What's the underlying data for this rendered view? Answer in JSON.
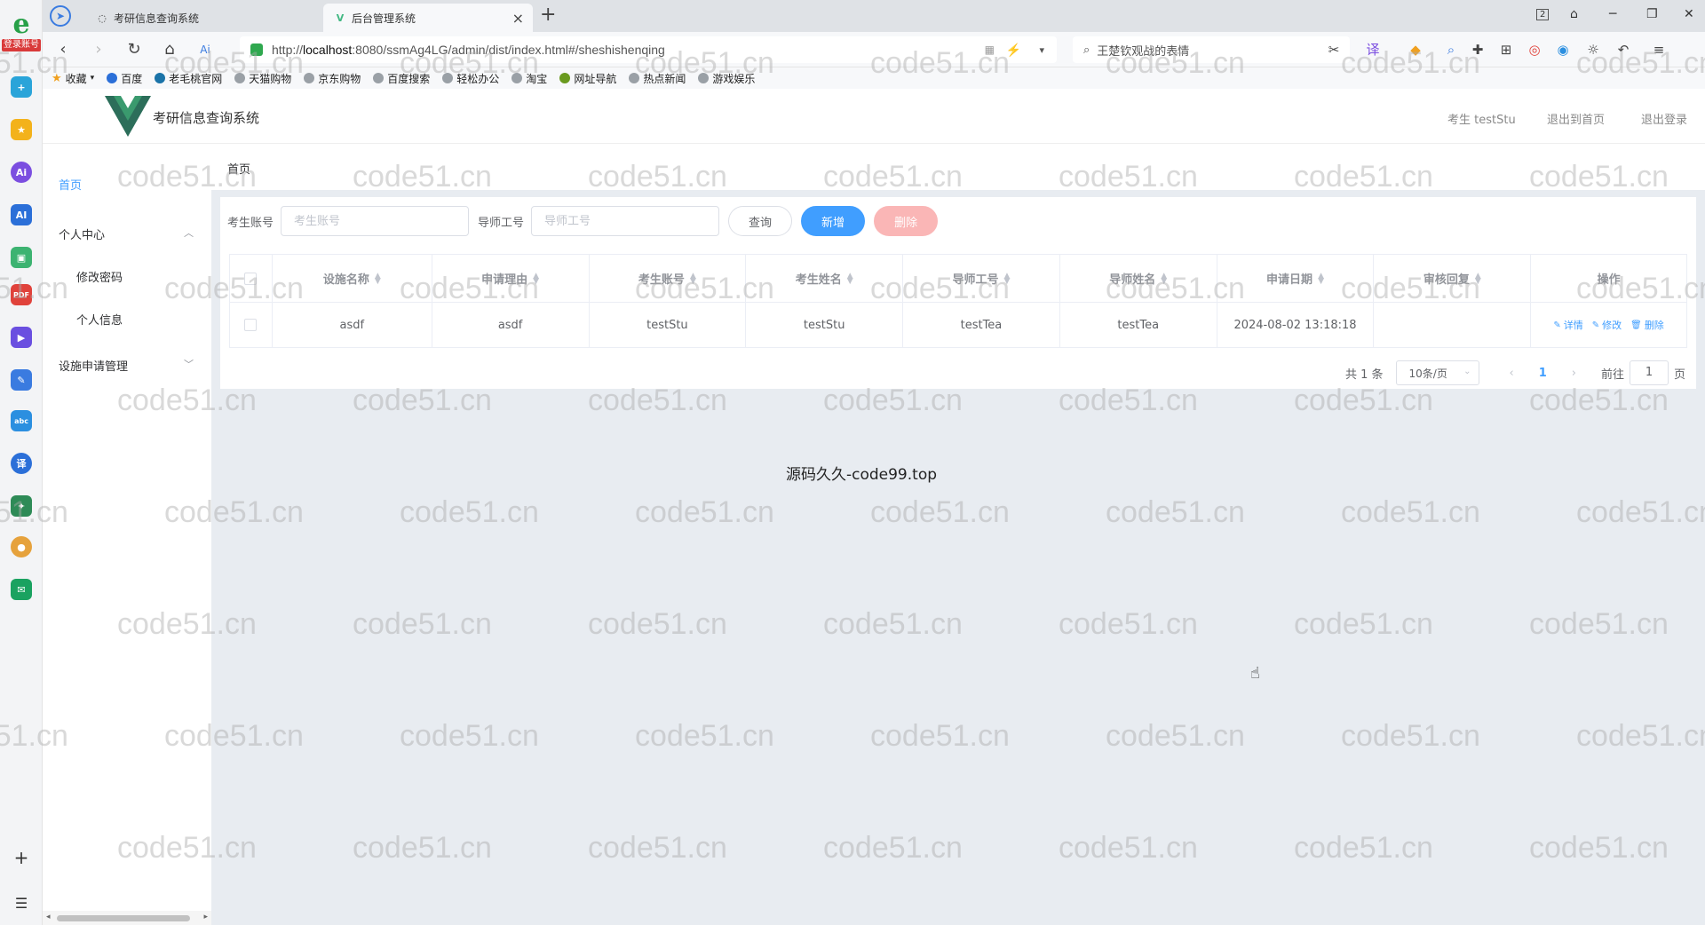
{
  "browser": {
    "login_badge": "登录账号",
    "tabs": [
      {
        "title": "考研信息查询系统"
      },
      {
        "title": "后台管理系统"
      }
    ],
    "url_prefix": "http://",
    "url_host": "localhost",
    "url_rest": ":8080/ssmAg4LG/admin/dist/index.html#/sheshishenqing",
    "search_text": "王楚钦观战的表情",
    "window_badge": "2",
    "bookmarks": [
      "收藏",
      "百度",
      "老毛桃官网",
      "天猫购物",
      "京东购物",
      "百度搜索",
      "轻松办公",
      "淘宝",
      "网址导航",
      "热点新闻",
      "游戏娱乐"
    ]
  },
  "header": {
    "title": "考研信息查询系统",
    "user_label": "考生 testStu",
    "back_home": "退出到首页",
    "logout": "退出登录"
  },
  "sidebar": {
    "home": "首页",
    "personal_center": "个人中心",
    "change_password": "修改密码",
    "personal_info": "个人信息",
    "facility_mgmt": "设施申请管理"
  },
  "breadcrumb": "首页",
  "search": {
    "student_label": "考生账号",
    "student_placeholder": "考生账号",
    "tutor_label": "导师工号",
    "tutor_placeholder": "导师工号",
    "query_btn": "查询",
    "add_btn": "新增",
    "delete_btn": "删除"
  },
  "table": {
    "columns": [
      "设施名称",
      "申请理由",
      "考生账号",
      "考生姓名",
      "导师工号",
      "导师姓名",
      "申请日期",
      "审核回复",
      "操作"
    ],
    "rows": [
      {
        "name": "asdf",
        "reason": "asdf",
        "student_account": "testStu",
        "student_name": "testStu",
        "tutor_id": "testTea",
        "tutor_name": "testTea",
        "date": "2024-08-02 13:18:18",
        "reply": ""
      }
    ],
    "actions": {
      "detail": "详情",
      "edit": "修改",
      "delete": "删除"
    }
  },
  "pagination": {
    "total": "共 1 条",
    "page_size": "10条/页",
    "current": "1",
    "goto_label": "前往",
    "goto_value": "1",
    "page_unit": "页"
  },
  "footer": "源码久久-code99.top",
  "watermark": "code51.cn",
  "colors": {
    "primary": "#409eff",
    "danger_light": "#fab6b6",
    "main_bg": "#e8ecf1"
  }
}
